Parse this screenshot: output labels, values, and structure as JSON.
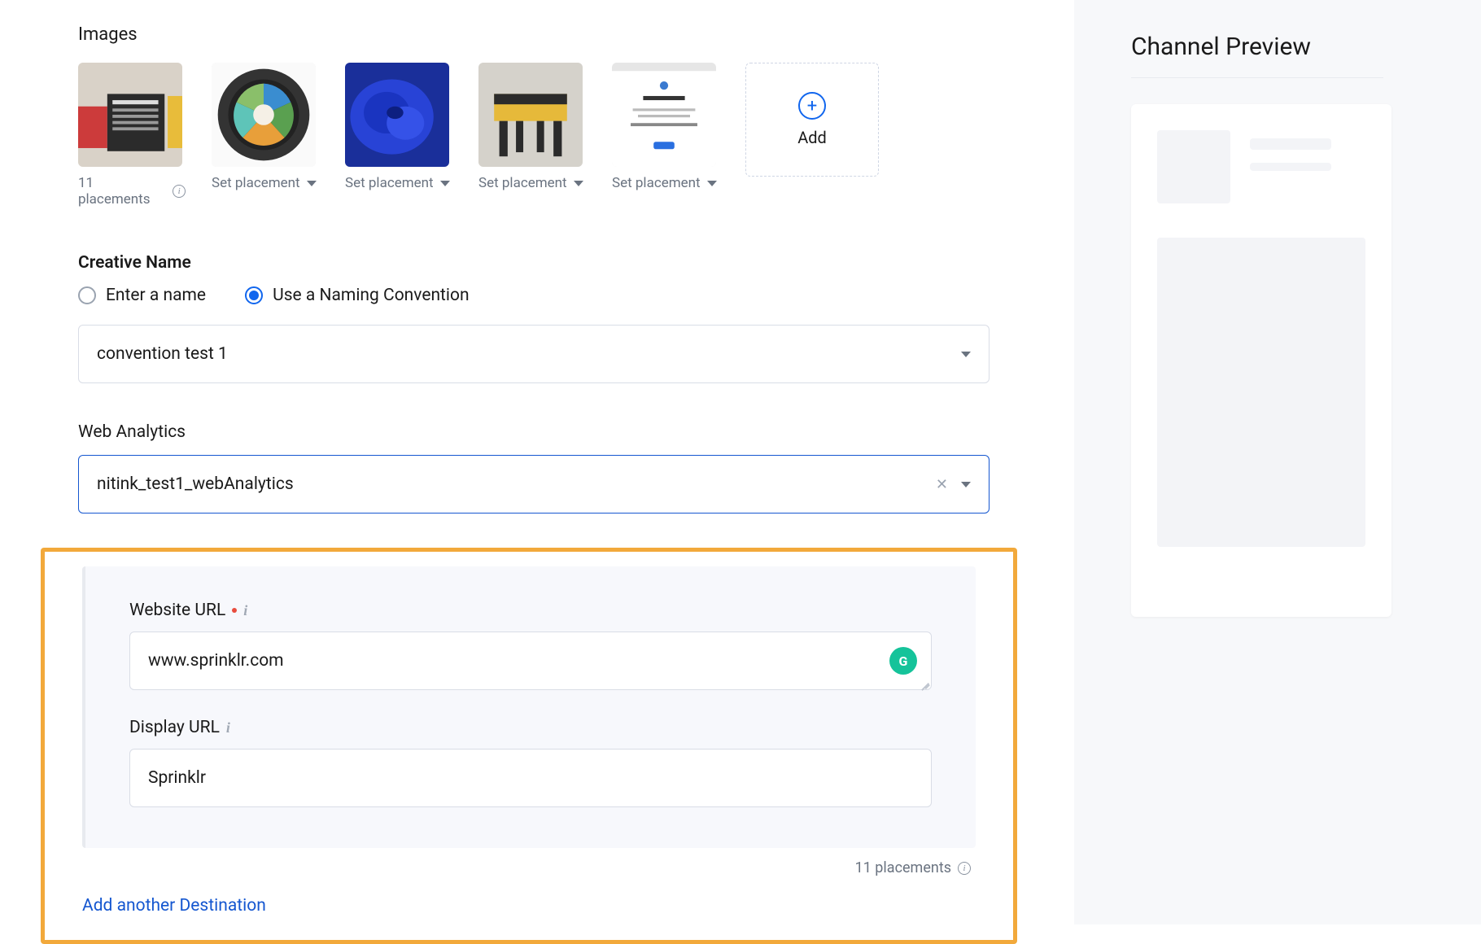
{
  "images": {
    "heading": "Images",
    "items": [
      {
        "caption": "11 placements",
        "type": "info"
      },
      {
        "caption": "Set placement",
        "type": "dropdown"
      },
      {
        "caption": "Set placement",
        "type": "dropdown"
      },
      {
        "caption": "Set placement",
        "type": "dropdown"
      },
      {
        "caption": "Set placement",
        "type": "dropdown"
      }
    ],
    "add_label": "Add"
  },
  "creative_name": {
    "label": "Creative Name",
    "options": {
      "enter": "Enter a name",
      "convention": "Use a Naming Convention"
    },
    "selected": "convention",
    "value": "convention test 1"
  },
  "web_analytics": {
    "label": "Web Analytics",
    "value": "nitink_test1_webAnalytics"
  },
  "destination": {
    "website_url": {
      "label": "Website URL",
      "value": "www.sprinklr.com",
      "required": true
    },
    "display_url": {
      "label": "Display URL",
      "value": "Sprinklr",
      "required": false
    },
    "placements_count": "11 placements",
    "add_link": "Add another Destination"
  },
  "sidebar": {
    "title": "Channel Preview"
  }
}
